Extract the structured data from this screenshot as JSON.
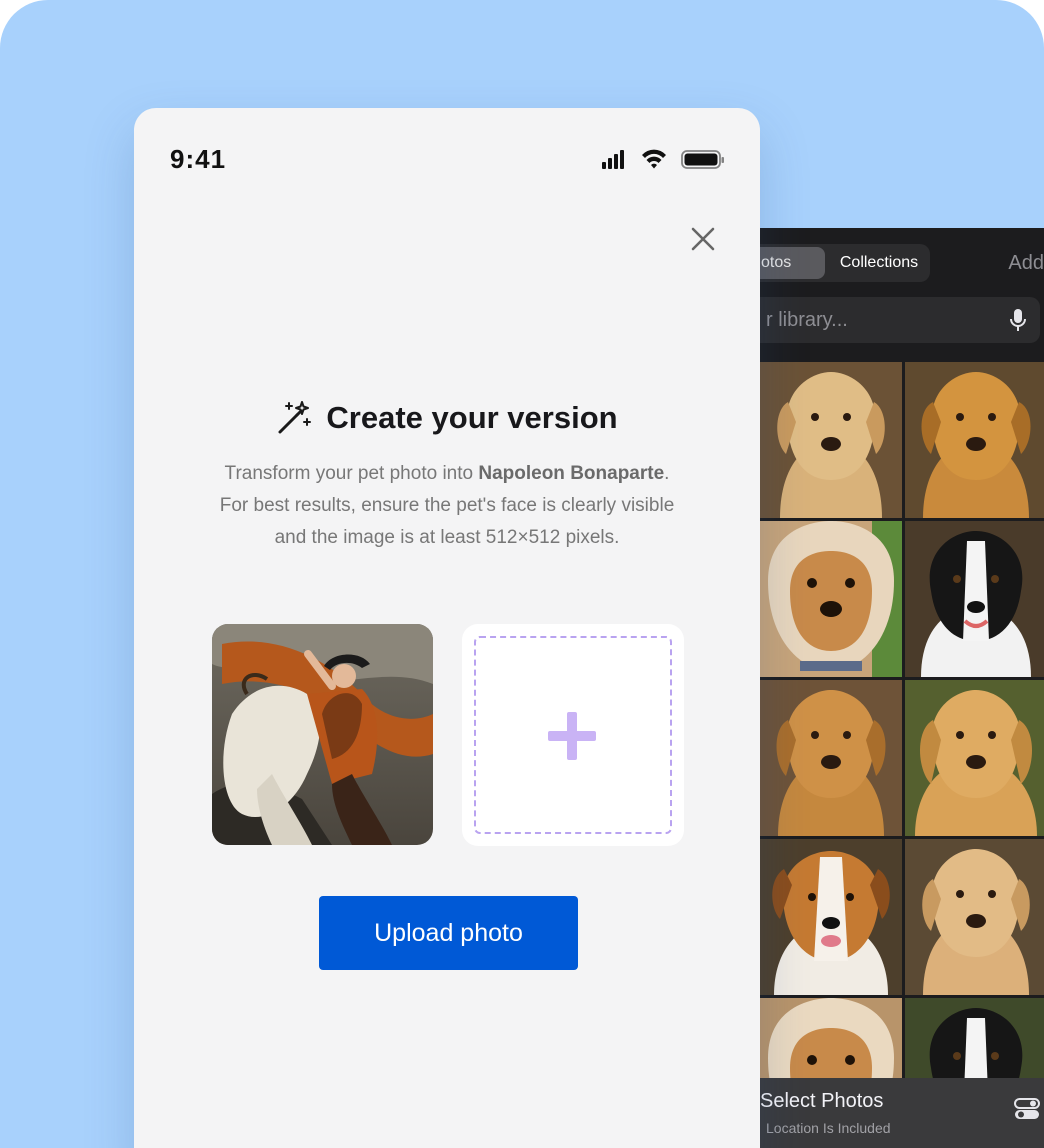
{
  "picker": {
    "tab_photos": "otos",
    "tab_collections": "Collections",
    "add_label": "Add",
    "search_placeholder": "r library...",
    "sheet_title": "Select Photos",
    "sheet_subtitle": "Location Is Included"
  },
  "status_bar": {
    "time": "9:41"
  },
  "modal": {
    "title": "Create your version",
    "desc_prefix": "Transform your pet photo into ",
    "desc_subject": "Napoleon Bonaparte",
    "desc_suffix": ".",
    "desc_line2": "For best results, ensure the pet's face is clearly visible",
    "desc_line3": "and the image is at least 512×512 pixels.",
    "upload_label": "Upload photo"
  },
  "colors": {
    "background": "#a8d1fc",
    "primary_button": "#0059d6",
    "accent_plus": "#c9b3f5",
    "modal_bg": "#f4f4f5",
    "picker_bg": "#1c1c1e"
  },
  "icons": {
    "title": "magic-wand-icon",
    "close": "close-icon",
    "add": "plus-icon",
    "mic": "microphone-icon",
    "toggle": "toggle-icon"
  }
}
